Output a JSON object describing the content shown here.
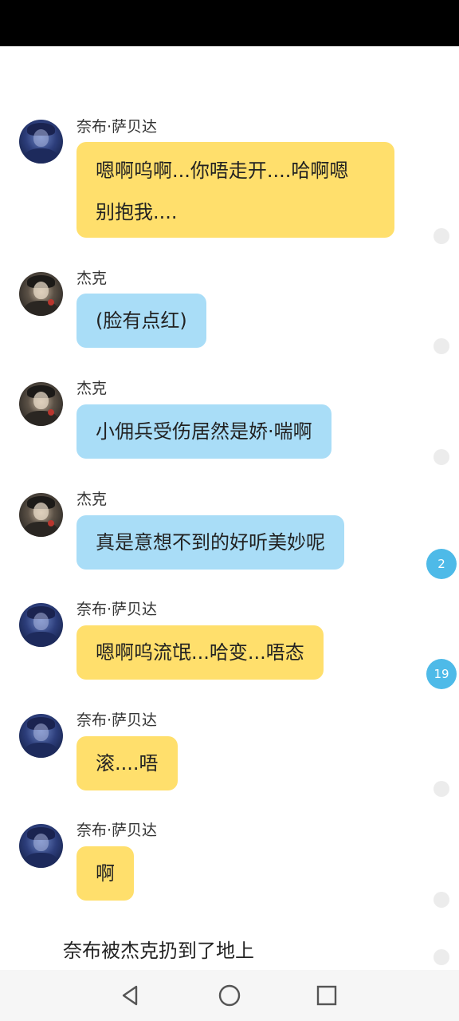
{
  "messages": [
    {
      "sender": "奈布·萨贝达",
      "text_lines": [
        "嗯啊呜啊...你唔走开....哈啊嗯",
        "别抱我...."
      ],
      "avatar": "nabu-avatar",
      "bubble_color": "#ffdf6c"
    },
    {
      "sender": "杰克",
      "text": "(脸有点红)",
      "avatar": "jack-avatar",
      "bubble_color": "#a9ddf7"
    },
    {
      "sender": "杰克",
      "text": "小佣兵受伤居然是娇·喘啊",
      "avatar": "jack-avatar",
      "bubble_color": "#a9ddf7"
    },
    {
      "sender": "杰克",
      "text": "真是意想不到的好听美妙呢",
      "avatar": "jack-avatar",
      "bubble_color": "#a9ddf7"
    },
    {
      "sender": "奈布·萨贝达",
      "text": "嗯啊呜流氓...哈变...唔态",
      "avatar": "nabu-avatar",
      "bubble_color": "#ffdf6c"
    },
    {
      "sender": "奈布·萨贝达",
      "text": "滚....唔",
      "avatar": "nabu-avatar",
      "bubble_color": "#ffdf6c"
    },
    {
      "sender": "奈布·萨贝达",
      "text": "啊",
      "avatar": "nabu-avatar",
      "bubble_color": "#ffdf6c"
    }
  ],
  "narration": "奈布被杰克扔到了地上",
  "comment_badges": [
    "2",
    "19"
  ],
  "nav": {
    "back": "back-triangle-icon",
    "home": "home-circle-icon",
    "recents": "recents-square-icon"
  }
}
